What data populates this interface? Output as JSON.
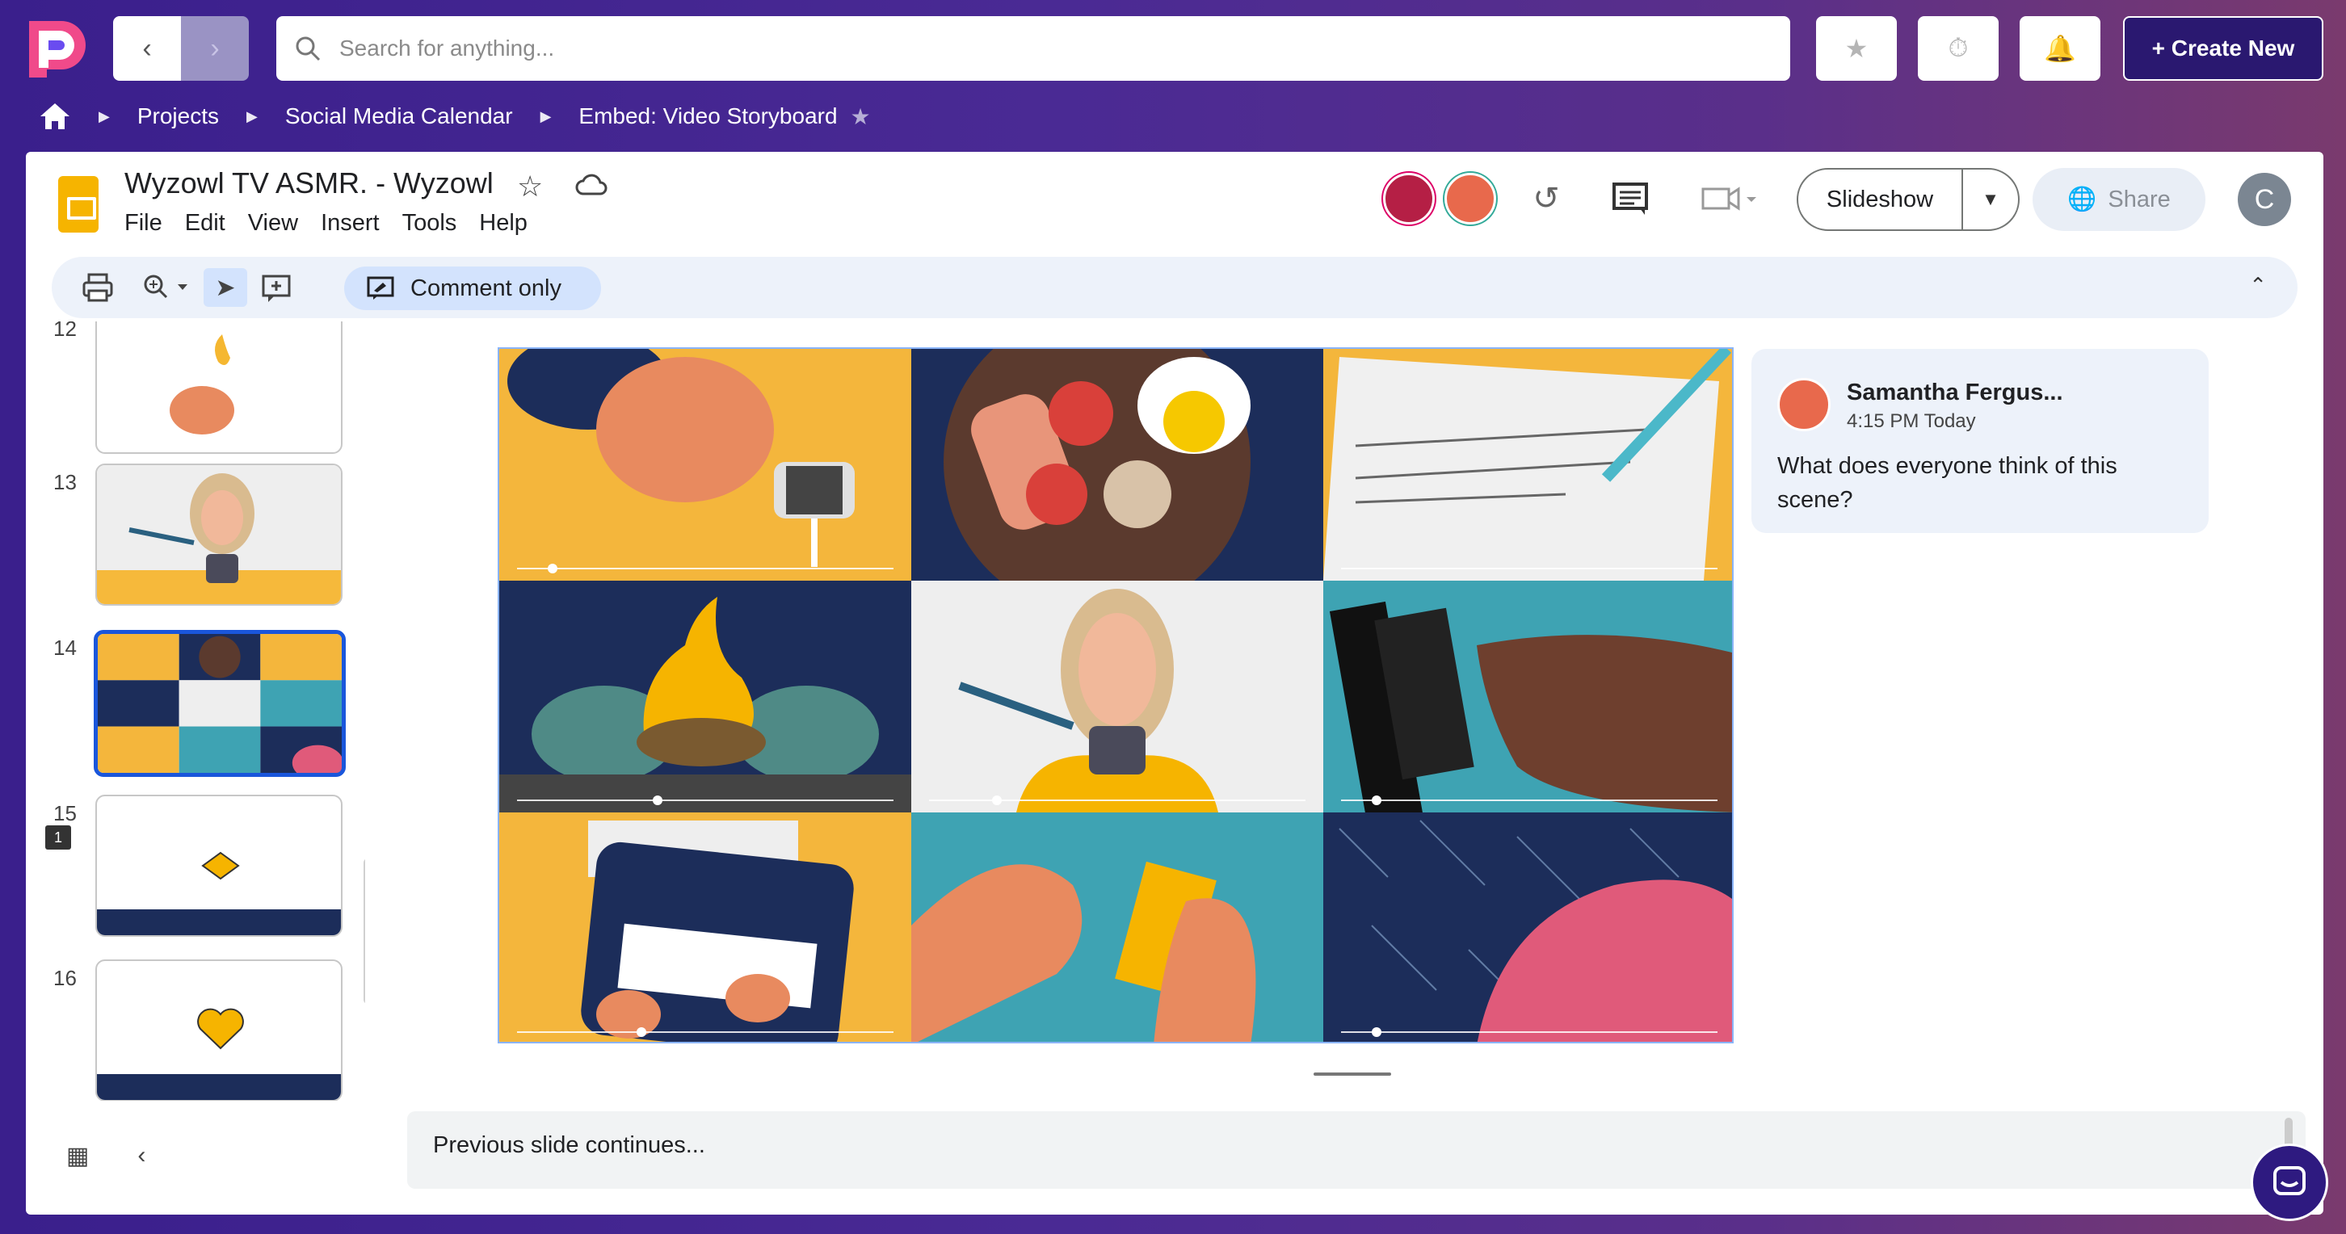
{
  "app": {
    "search_placeholder": "Search for anything...",
    "create_label": "+ Create New",
    "colors": {
      "brand": "#2a1870",
      "accent": "#1a56db",
      "bg_start": "#3a1f8c"
    }
  },
  "breadcrumb": [
    "Projects",
    "Social Media Calendar",
    "Embed: Video Storyboard"
  ],
  "doc": {
    "title": "Wyzowl TV ASMR. - Wyzowl",
    "menu": [
      "File",
      "Edit",
      "View",
      "Insert",
      "Tools",
      "Help"
    ],
    "slideshow_label": "Slideshow",
    "share_label": "Share",
    "account_initial": "C"
  },
  "toolbar": {
    "mode_label": "Comment only"
  },
  "filmstrip": {
    "slides": [
      {
        "number": "12"
      },
      {
        "number": "13"
      },
      {
        "number": "14",
        "comments": "1"
      },
      {
        "number": "15"
      },
      {
        "number": "16"
      }
    ]
  },
  "comment": {
    "author": "Samantha Fergus...",
    "time": "4:15 PM Today",
    "text": "What does everyone think of this scene?"
  },
  "notes": {
    "text": "Previous slide continues..."
  },
  "icons": [
    "home-icon",
    "chevron-left-icon",
    "chevron-right-icon",
    "search-icon",
    "star-icon",
    "timer-icon",
    "bell-icon",
    "cloud-icon",
    "history-icon",
    "comment-icon",
    "video-icon",
    "globe-icon",
    "print-icon",
    "zoom-icon",
    "cursor-icon",
    "add-comment-icon",
    "chevron-up-icon",
    "grid-icon",
    "chat-icon"
  ]
}
